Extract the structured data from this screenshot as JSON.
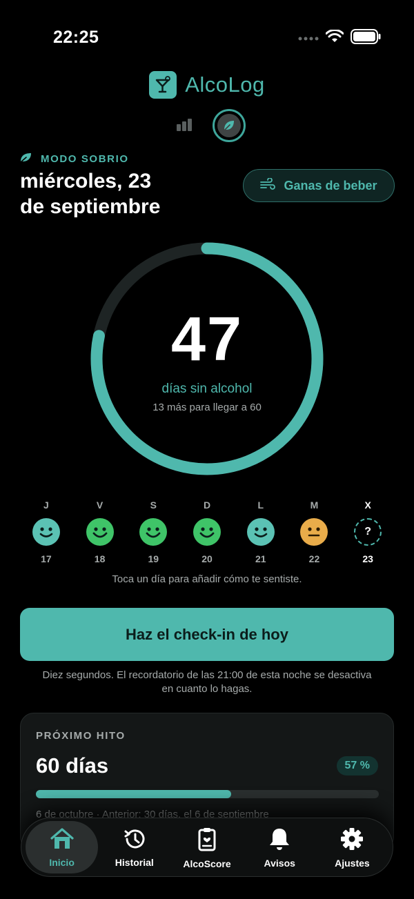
{
  "status": {
    "time": "22:25"
  },
  "app": {
    "name": "AlcoLog",
    "accent": "#4fb8ad"
  },
  "mode": {
    "label": "MODO SOBRIO"
  },
  "date": {
    "line1": "miércoles, 23",
    "line2": "de septiembre"
  },
  "urge_button": {
    "label": "Ganas de beber"
  },
  "streak": {
    "days": "47",
    "label": "días sin alcohol",
    "sub": "13 más para llegar a 60",
    "progress": 0.783
  },
  "week": {
    "days": [
      {
        "letter": "J",
        "num": "17",
        "mood": "content",
        "color": "#5bc2b4"
      },
      {
        "letter": "V",
        "num": "18",
        "mood": "happy",
        "color": "#3fc468"
      },
      {
        "letter": "S",
        "num": "19",
        "mood": "happy",
        "color": "#3fc468"
      },
      {
        "letter": "D",
        "num": "20",
        "mood": "happy",
        "color": "#3fc468"
      },
      {
        "letter": "L",
        "num": "21",
        "mood": "content",
        "color": "#5bc2b4"
      },
      {
        "letter": "M",
        "num": "22",
        "mood": "neutral",
        "color": "#e9ac4a"
      },
      {
        "letter": "X",
        "num": "23",
        "mood": "unknown",
        "color": "#4fb8ad",
        "glyph": "?"
      }
    ],
    "hint": "Toca un día para añadir cómo te sentiste."
  },
  "checkin": {
    "label": "Haz el check-in de hoy",
    "note_line1": "Diez segundos. El recordatorio de las 21:00 de esta noche se desactiva",
    "note_line2": "en cuanto lo hagas."
  },
  "milestone": {
    "label": "PRÓXIMO HITO",
    "title": "60 días",
    "percent": "57 %",
    "progress": 0.57,
    "sub": "6 de octubre · Anterior: 30 días, el 6 de septiembre"
  },
  "tabs": [
    {
      "label": "Inicio",
      "icon": "home-icon",
      "active": true
    },
    {
      "label": "Historial",
      "icon": "history-icon"
    },
    {
      "label": "AlcoScore",
      "icon": "clipboard-icon"
    },
    {
      "label": "Avisos",
      "icon": "bell-icon"
    },
    {
      "label": "Ajustes",
      "icon": "gear-icon"
    }
  ]
}
